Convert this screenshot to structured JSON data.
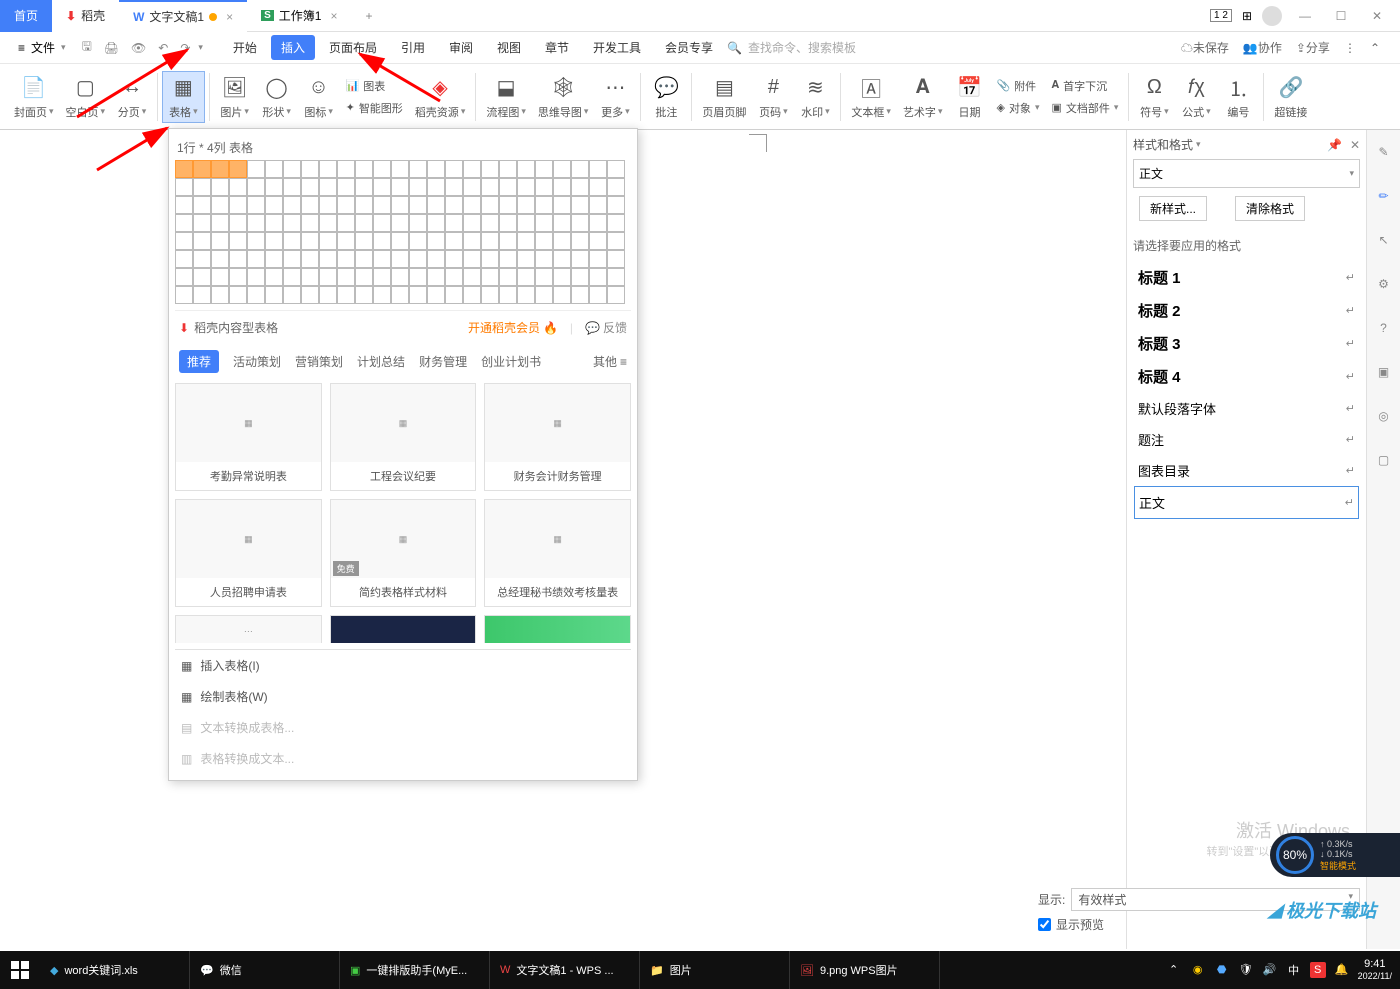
{
  "title_tabs": {
    "home": "首页",
    "docer": "稻壳",
    "doc": "文字文稿1",
    "sheet": "工作簿1"
  },
  "menu": {
    "file": "文件",
    "items": [
      "开始",
      "插入",
      "页面布局",
      "引用",
      "审阅",
      "视图",
      "章节",
      "开发工具",
      "会员专享"
    ],
    "active": "插入",
    "search_placeholder": "查找命令、搜索模板",
    "unsaved": "未保存",
    "collab": "协作",
    "share": "分享"
  },
  "ribbon": {
    "cover": "封面页",
    "blank": "空白页",
    "break": "分页",
    "table": "表格",
    "image": "图片",
    "shape": "形状",
    "icon": "图标",
    "chart": "图表",
    "smart": "智能图形",
    "docer_res": "稻壳资源",
    "flow": "流程图",
    "mind": "思维导图",
    "more": "更多",
    "comment": "批注",
    "headerfooter": "页眉页脚",
    "pagenum": "页码",
    "watermark": "水印",
    "textbox": "文本框",
    "wordart": "艺术字",
    "date": "日期",
    "attach": "附件",
    "object": "对象",
    "dropcap": "首字下沉",
    "docpart": "文档部件",
    "symbol": "符号",
    "formula": "公式",
    "number": "编号",
    "hyperlink": "超链接"
  },
  "table_dropdown": {
    "size_label": "1行 * 4列 表格",
    "type_label": "稻壳内容型表格",
    "vip_link": "开通稻壳会员",
    "feedback": "反馈",
    "tabs": [
      "推荐",
      "活动策划",
      "营销策划",
      "计划总结",
      "财务管理",
      "创业计划书"
    ],
    "tab_other": "其他",
    "templates": [
      {
        "name": "考勤异常说明表",
        "badge": ""
      },
      {
        "name": "工程会议纪要",
        "badge": ""
      },
      {
        "name": "财务会计财务管理",
        "badge": ""
      },
      {
        "name": "人员招聘申请表",
        "badge": ""
      },
      {
        "name": "简约表格样式材料",
        "badge": "免费"
      },
      {
        "name": "总经理秘书绩效考核量表",
        "badge": ""
      }
    ],
    "insert_table": "插入表格(I)",
    "draw_table": "绘制表格(W)",
    "text_to_table": "文本转换成表格...",
    "table_to_text": "表格转换成文本..."
  },
  "right_panel": {
    "title": "样式和格式",
    "current_style": "正文",
    "new_style": "新样式...",
    "clear_format": "清除格式",
    "section_label": "请选择要应用的格式",
    "styles": [
      {
        "label": "标题 1",
        "bold": true
      },
      {
        "label": "标题 2",
        "bold": true
      },
      {
        "label": "标题 3",
        "bold": true
      },
      {
        "label": "标题 4",
        "bold": true
      },
      {
        "label": "默认段落字体",
        "bold": false
      },
      {
        "label": "题注",
        "bold": false
      },
      {
        "label": "图表目录",
        "bold": false
      },
      {
        "label": "正文",
        "bold": false,
        "selected": true
      }
    ],
    "display_label": "显示:",
    "display_value": "有效样式",
    "preview": "显示预览"
  },
  "watermark": {
    "line1": "激活 Windows",
    "line2": "转到\"设置\"以激活 Windows。"
  },
  "speed": {
    "pct": "80%",
    "up": "0.3K/s",
    "down": "0.1K/s",
    "smart": "智能模式"
  },
  "logo": "极光下载站",
  "taskbar": {
    "items": [
      "word关键词.xls",
      "微信",
      "一键排版助手(MyE...",
      "文字文稿1 - WPS ...",
      "图片",
      "9.png  WPS图片"
    ],
    "time": "9:41",
    "date": "2022/11/"
  }
}
